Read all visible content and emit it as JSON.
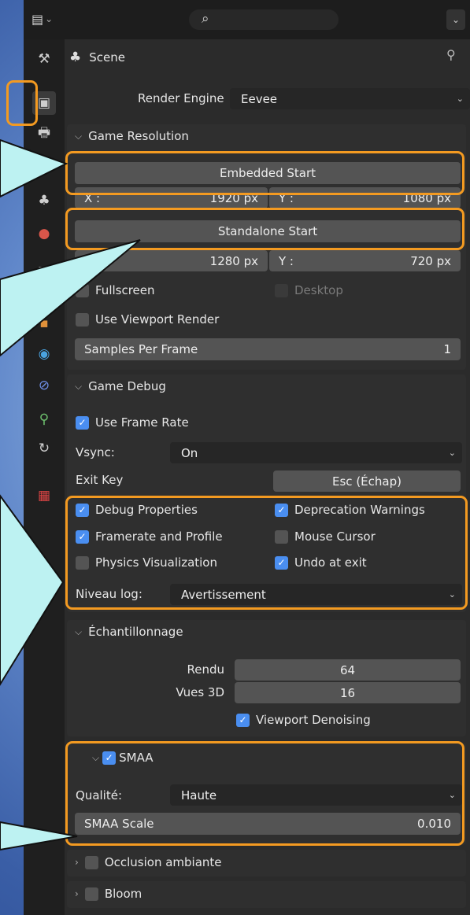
{
  "header": {
    "editor_icon": "properties-editor-icon",
    "search_icon": "search-icon",
    "menu_icon": "chevron-down-icon",
    "scene_label": "Scene",
    "pin_icon": "pin-icon"
  },
  "tabs": [
    "tool-icon",
    "render-icon",
    "output-icon",
    "view-layer-icon",
    "scene-icon",
    "world-icon",
    "collection-icon",
    "object-icon",
    "modifier-icon",
    "particles-icon",
    "physics-icon",
    "constraints-icon",
    "data-icon",
    "material-icon",
    "texture-icon"
  ],
  "render_engine": {
    "label": "Render Engine",
    "value": "Eevee"
  },
  "game_resolution": {
    "title": "Game Resolution",
    "embedded_start": "Embedded Start",
    "embedded_x_label": "X :",
    "embedded_x": "1920 px",
    "embedded_y_label": "Y :",
    "embedded_y": "1080 px",
    "standalone_start": "Standalone Start",
    "standalone_x_label": "X :",
    "standalone_x": "1280 px",
    "standalone_y_label": "Y :",
    "standalone_y": "720 px",
    "fullscreen": "Fullscreen",
    "fullscreen_checked": false,
    "desktop": "Desktop",
    "desktop_checked": false,
    "use_viewport_render": "Use Viewport Render",
    "use_viewport_render_checked": false,
    "samples_per_frame_label": "Samples Per Frame",
    "samples_per_frame": "1"
  },
  "game_debug": {
    "title": "Game Debug",
    "use_frame_rate": "Use Frame Rate",
    "use_frame_rate_checked": true,
    "vsync_label": "Vsync:",
    "vsync_value": "On",
    "exit_key_label": "Exit Key",
    "exit_key_value": "Esc (Échap)",
    "debug_properties": "Debug Properties",
    "debug_properties_checked": true,
    "deprecation_warnings": "Deprecation Warnings",
    "deprecation_warnings_checked": true,
    "framerate_profile": "Framerate and Profile",
    "framerate_profile_checked": true,
    "mouse_cursor": "Mouse Cursor",
    "mouse_cursor_checked": false,
    "physics_visualization": "Physics Visualization",
    "physics_visualization_checked": false,
    "undo_at_exit": "Undo at exit",
    "undo_at_exit_checked": true,
    "log_level_label": "Niveau log:",
    "log_level_value": "Avertissement"
  },
  "sampling": {
    "title": "Échantillonnage",
    "render_label": "Rendu",
    "render_value": "64",
    "viewport_label": "Vues 3D",
    "viewport_value": "16",
    "viewport_denoising": "Viewport Denoising",
    "viewport_denoising_checked": true
  },
  "smaa": {
    "title": "SMAA",
    "enabled": true,
    "quality_label": "Qualité:",
    "quality_value": "Haute",
    "scale_label": "SMAA Scale",
    "scale_value": "0.010"
  },
  "ambient_occlusion": {
    "title": "Occlusion ambiante",
    "enabled": false
  },
  "bloom": {
    "title": "Bloom",
    "enabled": false
  },
  "colors": {
    "highlight": "#f39a21",
    "callout": "#bdf2f2",
    "checkbox_on": "#4a8ef0"
  }
}
